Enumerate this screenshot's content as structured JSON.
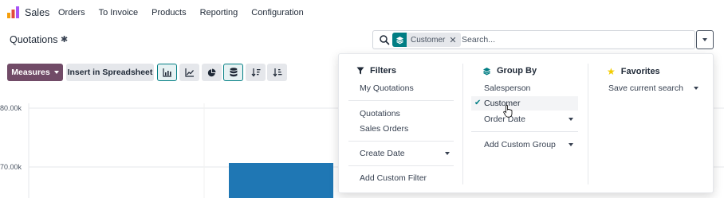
{
  "app": {
    "name": "Sales"
  },
  "nav": {
    "items": [
      "Orders",
      "To Invoice",
      "Products",
      "Reporting",
      "Configuration"
    ]
  },
  "control_panel": {
    "title": "Quotations"
  },
  "search": {
    "facet_value": "Customer",
    "placeholder": "Search..."
  },
  "toolbar": {
    "measures_label": "Measures",
    "insert_label": "Insert in Spreadsheet"
  },
  "chart": {
    "y_ticks": [
      "80.00k",
      "70.00k"
    ]
  },
  "filters": {
    "title": "Filters",
    "items": [
      "My Quotations",
      "Quotations",
      "Sales Orders",
      "Create Date",
      "Add Custom Filter"
    ]
  },
  "groupby": {
    "title": "Group By",
    "items": [
      "Salesperson",
      "Customer",
      "Order Date",
      "Add Custom Group"
    ],
    "selected": "Customer"
  },
  "favorites": {
    "title": "Favorites",
    "items": [
      "Save current search"
    ]
  },
  "colors": {
    "brand": "#714b67",
    "accent": "#017e84",
    "bar": "#1f77b4"
  }
}
